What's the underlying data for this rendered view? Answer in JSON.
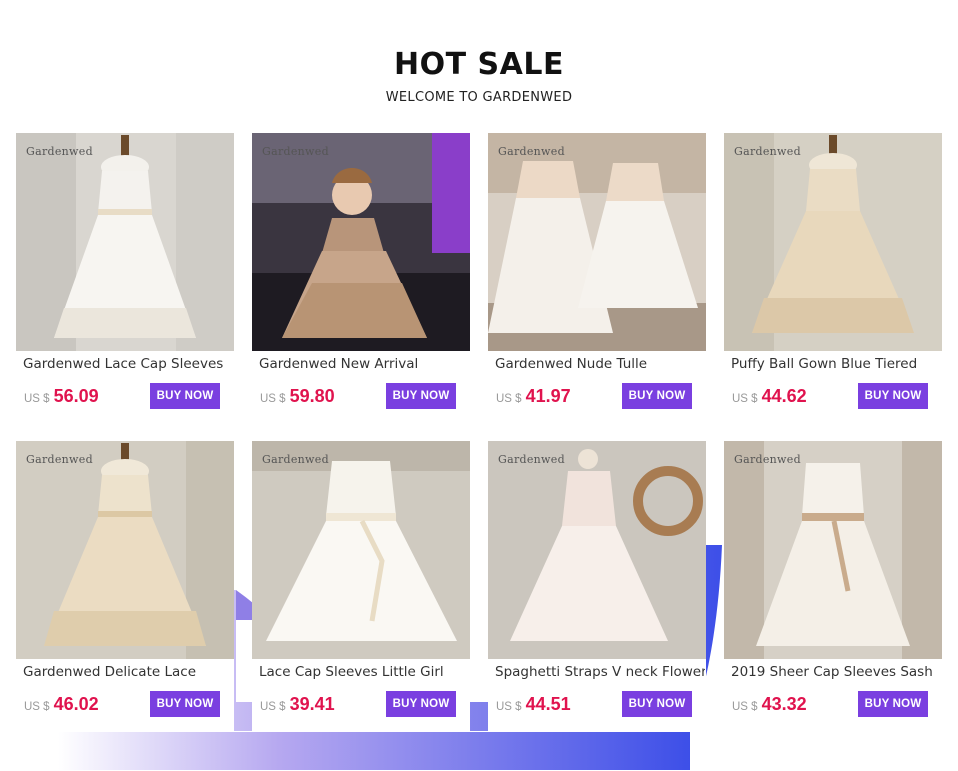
{
  "header": {
    "title": "HOT SALE",
    "subtitle": "WELCOME TO GARDENWED"
  },
  "colors": {
    "accent": "#7a3fe0",
    "price": "#e0134e",
    "swoosh": "#4a4ce8"
  },
  "products": [
    {
      "brand": "Gardenwed",
      "name": "Gardenwed Lace Cap Sleeves",
      "currency": "US $",
      "price": "56.09",
      "button": "BUY NOW",
      "image": "ivory-lace-dress-on-mannequin"
    },
    {
      "brand": "Gardenwed",
      "name": "Gardenwed New Arrival",
      "currency": "US $",
      "price": "59.80",
      "button": "BUY NOW",
      "image": "girl-in-gold-sequin-gown"
    },
    {
      "brand": "Gardenwed",
      "name": "Gardenwed Nude Tulle",
      "currency": "US $",
      "price": "41.97",
      "button": "BUY NOW",
      "image": "two-tulle-dresses-on-hangers"
    },
    {
      "brand": "Gardenwed",
      "name": "Puffy Ball Gown Blue Tiered",
      "currency": "US $",
      "price": "44.62",
      "button": "BUY NOW",
      "image": "champagne-ball-gown-on-mannequin"
    },
    {
      "brand": "Gardenwed",
      "name": "Gardenwed Delicate Lace",
      "currency": "US $",
      "price": "46.02",
      "button": "BUY NOW",
      "image": "champagne-lace-dress-on-mannequin"
    },
    {
      "brand": "Gardenwed",
      "name": "Lace Cap Sleeves Little Girl",
      "currency": "US $",
      "price": "39.41",
      "button": "BUY NOW",
      "image": "ivory-satin-dress-with-sash"
    },
    {
      "brand": "Gardenwed",
      "name": "Spaghetti Straps V neck Flower",
      "currency": "US $",
      "price": "44.51",
      "button": "BUY NOW",
      "image": "blush-dress-with-wreath"
    },
    {
      "brand": "Gardenwed",
      "name": "2019 Sheer Cap Sleeves Sash",
      "currency": "US $",
      "price": "43.32",
      "button": "BUY NOW",
      "image": "ivory-dress-with-bow-sash"
    }
  ]
}
